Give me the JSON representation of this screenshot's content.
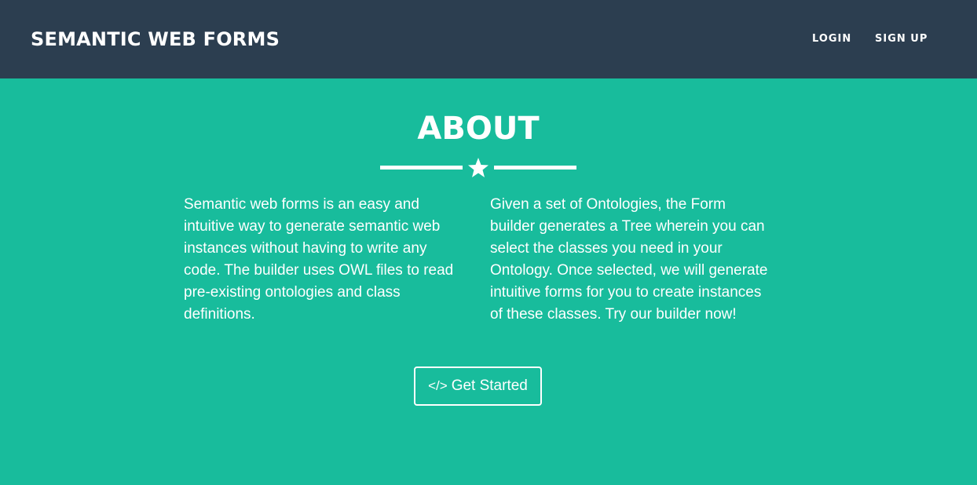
{
  "navbar": {
    "brand": "SEMANTIC WEB FORMS",
    "links": {
      "login": "LOGIN",
      "signup": "SIGN UP"
    },
    "background_color": "#2c3e50"
  },
  "about": {
    "title": "ABOUT",
    "divider_icon": "star-icon",
    "left_text": "Semantic web forms is an easy and intuitive way to generate semantic web instances without having to write any code. The builder uses OWL files to read pre-existing ontologies and class definitions.",
    "right_text": "Given a set of Ontologies, the Form builder generates a Tree wherein you can select the classes you need in your Ontology. Once selected, we will generate intuitive forms for you to create instances of these classes. Try our builder now!",
    "button": {
      "icon": "code-icon",
      "icon_glyph": "</>",
      "label": "Get Started"
    },
    "background_color": "#18bc9c"
  }
}
